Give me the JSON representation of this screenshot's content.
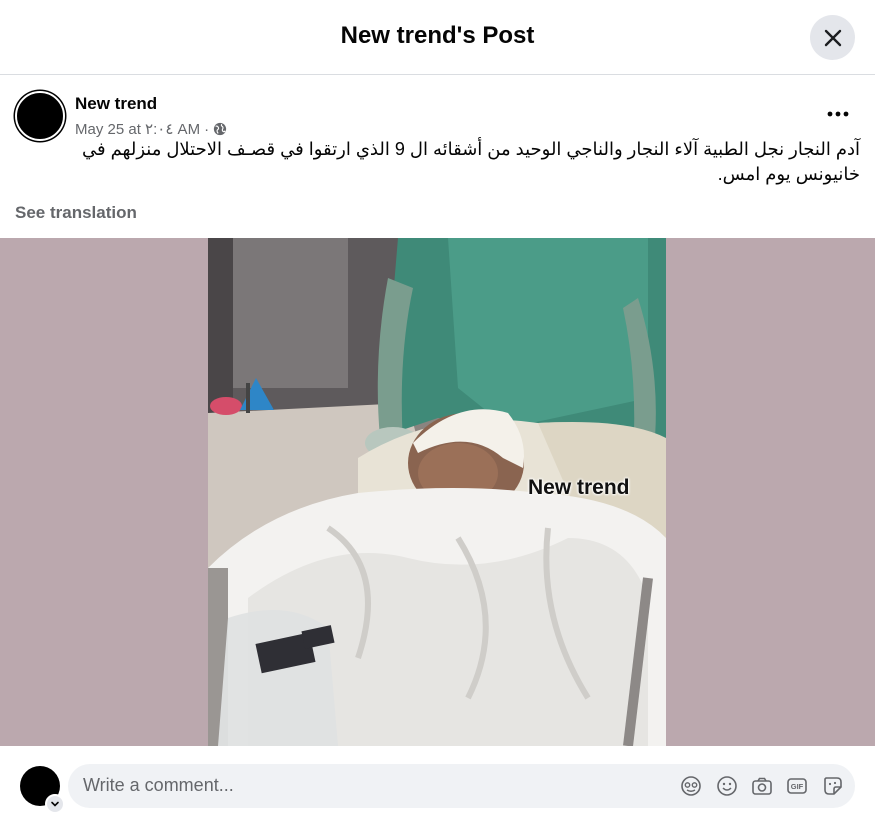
{
  "dialog": {
    "title": "New trend's Post"
  },
  "post": {
    "author": "New trend",
    "date": "May 25 at ٢:٠٤ AM",
    "separator": "·",
    "text": "آدم النجار نجل الطبية آلاء النجار والناجي الوحيد من أشقائه ال 9 الذي ارتقوا في قصـف الاحتلال منزلهم في خانيونس يوم امس.",
    "see_translation": "See translation",
    "video_watermark": "New trend",
    "media_background": "#bba8ae"
  },
  "comment": {
    "placeholder": "Write a comment...",
    "icons": [
      "avatar-sticker-icon",
      "emoji-icon",
      "camera-icon",
      "gif-icon",
      "sticker-icon"
    ]
  },
  "icons": {
    "close": "close-icon",
    "privacy": "globe-icon",
    "more": "more-options-icon",
    "avatar_menu": "chevron-down-icon"
  }
}
